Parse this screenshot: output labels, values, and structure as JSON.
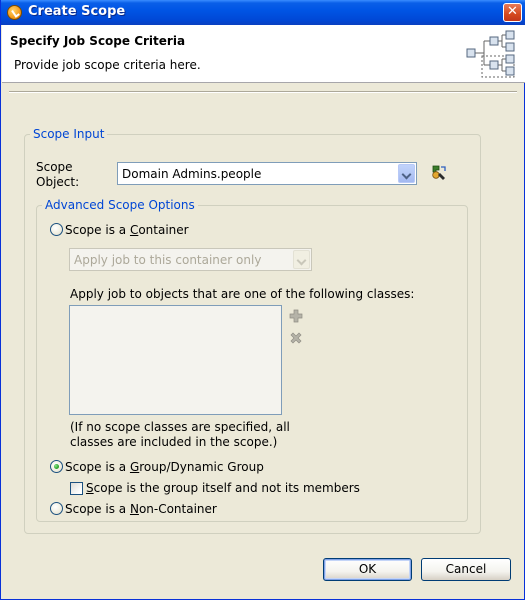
{
  "window": {
    "title": "Create Scope"
  },
  "banner": {
    "title": "Specify Job Scope Criteria",
    "description": "Provide job scope criteria here."
  },
  "scope_input": {
    "legend": "Scope Input",
    "scope_object_label_line1": "Scope",
    "scope_object_label_line2": "Object:",
    "scope_object_value": "Domain Admins.people"
  },
  "advanced": {
    "legend": "Advanced Scope Options",
    "container_radio": {
      "prefix": "Scope is a ",
      "mnemonic": "C",
      "rest": "ontainer",
      "checked": false
    },
    "container_combo_value": "Apply job to this container only",
    "classes_label": "Apply job to objects that are one of the following classes:",
    "classes": [],
    "note_line1": "(If no scope classes are specified, all",
    "note_line2": "classes are included in the scope.)",
    "group_radio": {
      "prefix": "Scope is a ",
      "mnemonic": "G",
      "rest": "roup/Dynamic Group",
      "checked": true
    },
    "group_checkbox": {
      "mnemonic": "S",
      "rest": "cope is the group itself and not its members",
      "checked": false
    },
    "noncontainer_radio": {
      "prefix": "Scope is a ",
      "mnemonic": "N",
      "rest": "on-Container",
      "checked": false
    }
  },
  "buttons": {
    "ok": "OK",
    "cancel": "Cancel"
  },
  "icons": {
    "title": "app-icon",
    "close": "close-icon",
    "banner": "hierarchy-icon",
    "browse": "object-selector-icon",
    "add": "add-icon",
    "remove": "remove-icon"
  }
}
